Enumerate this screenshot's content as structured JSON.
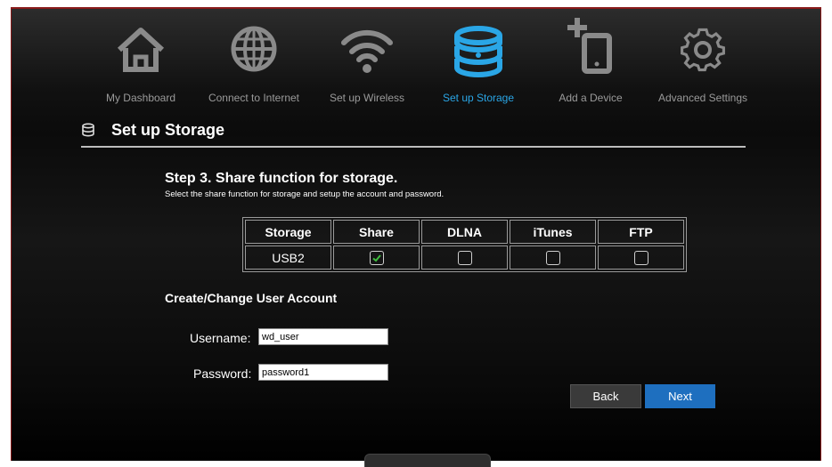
{
  "nav": {
    "items": [
      {
        "label": "My Dashboard",
        "icon": "home-icon"
      },
      {
        "label": "Connect to Internet",
        "icon": "globe-icon"
      },
      {
        "label": "Set up Wireless",
        "icon": "wifi-icon"
      },
      {
        "label": "Set up Storage",
        "icon": "storage-icon",
        "active": true
      },
      {
        "label": "Add a Device",
        "icon": "add-device-icon"
      },
      {
        "label": "Advanced Settings",
        "icon": "gear-icon"
      }
    ],
    "active_color": "#2aa6e6",
    "inactive_color": "#9a9a9a"
  },
  "page": {
    "title": "Set up Storage",
    "title_icon": "storage-small-icon"
  },
  "step": {
    "heading": "Step 3. Share function for storage.",
    "description": "Select the share function for storage and setup the account and password."
  },
  "share_table": {
    "headers": [
      "Storage",
      "Share",
      "DLNA",
      "iTunes",
      "FTP"
    ],
    "rows": [
      {
        "storage": "USB2",
        "share": true,
        "dlna": false,
        "itunes": false,
        "ftp": false
      }
    ]
  },
  "account": {
    "heading": "Create/Change User Account",
    "username_label": "Username:",
    "username_value": "wd_user",
    "password_label": "Password:",
    "password_value": "password1"
  },
  "buttons": {
    "back": "Back",
    "next": "Next"
  },
  "colors": {
    "accent": "#2aa6e6",
    "next_button": "#1e6fbf",
    "check": "#3fbf3f"
  }
}
